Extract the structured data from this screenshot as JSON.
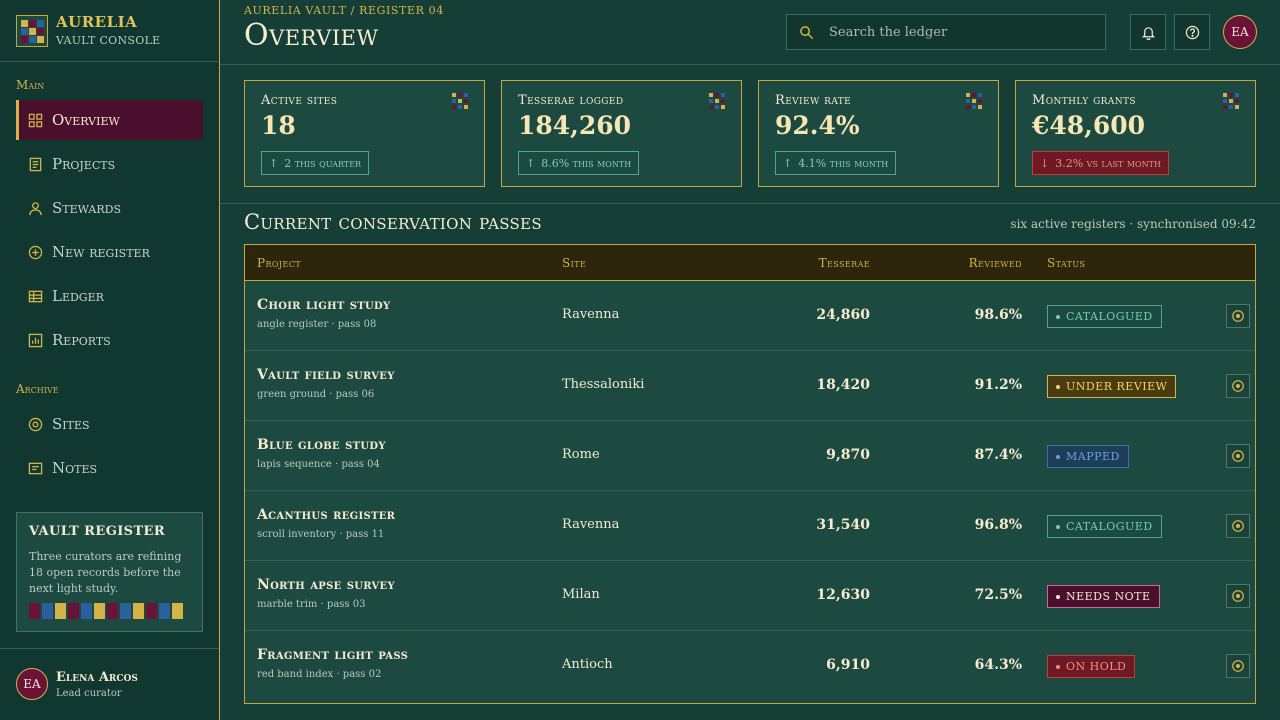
{
  "brand": {
    "name": "AURELIA",
    "subtitle": "VAULT CONSOLE"
  },
  "nav": {
    "main_label": "Main",
    "archive_label": "Archive",
    "main_items": [
      {
        "label": "Overview",
        "icon": "grid-icon",
        "active": true
      },
      {
        "label": "Projects",
        "icon": "document-icon"
      },
      {
        "label": "Stewards",
        "icon": "user-icon"
      },
      {
        "label": "New register",
        "icon": "plus-circle-icon"
      },
      {
        "label": "Ledger",
        "icon": "table-icon"
      },
      {
        "label": "Reports",
        "icon": "chart-icon"
      }
    ],
    "archive_items": [
      {
        "label": "Sites",
        "icon": "target-icon"
      },
      {
        "label": "Notes",
        "icon": "note-icon"
      }
    ]
  },
  "vault_card": {
    "title": "VAULT REGISTER",
    "text": "Three curators are refining 18 open records before the next light study."
  },
  "user": {
    "initials": "EA",
    "name": "Elena Arcos",
    "role": "Lead curator"
  },
  "header": {
    "breadcrumb": "AURELIA VAULT / REGISTER 04",
    "title": "Overview",
    "search_placeholder": "Search the ledger",
    "avatar_initials": "EA"
  },
  "stats": [
    {
      "label": "Active sites",
      "value": "18",
      "delta": "2 this quarter",
      "direction": "up"
    },
    {
      "label": "Tesserae logged",
      "value": "184,260",
      "delta": "8.6% this month",
      "direction": "up"
    },
    {
      "label": "Review rate",
      "value": "92.4%",
      "delta": "4.1% this month",
      "direction": "up"
    },
    {
      "label": "Monthly grants",
      "value": "€48,600",
      "delta": "3.2% vs last month",
      "direction": "down"
    }
  ],
  "table": {
    "title": "Current conservation passes",
    "meta": "six active registers · synchronised 09:42",
    "columns": [
      "Project",
      "Site",
      "Tesserae",
      "Reviewed",
      "Status"
    ],
    "rows": [
      {
        "project": "Choir light study",
        "sub": "angle register · pass 08",
        "site": "Ravenna",
        "tesserae": "24,860",
        "reviewed": "98.6%",
        "status": "CATALOGUED",
        "status_kind": "catalogued"
      },
      {
        "project": "Vault field survey",
        "sub": "green ground · pass 06",
        "site": "Thessaloniki",
        "tesserae": "18,420",
        "reviewed": "91.2%",
        "status": "UNDER REVIEW",
        "status_kind": "review"
      },
      {
        "project": "Blue globe study",
        "sub": "lapis sequence · pass 04",
        "site": "Rome",
        "tesserae": "9,870",
        "reviewed": "87.4%",
        "status": "MAPPED",
        "status_kind": "mapped"
      },
      {
        "project": "Acanthus register",
        "sub": "scroll inventory · pass 11",
        "site": "Ravenna",
        "tesserae": "31,540",
        "reviewed": "96.8%",
        "status": "CATALOGUED",
        "status_kind": "catalogued"
      },
      {
        "project": "North apse survey",
        "sub": "marble trim · pass 03",
        "site": "Milan",
        "tesserae": "12,630",
        "reviewed": "72.5%",
        "status": "NEEDS NOTE",
        "status_kind": "note"
      },
      {
        "project": "Fragment light pass",
        "sub": "red band index · pass 02",
        "site": "Antioch",
        "tesserae": "6,910",
        "reviewed": "64.3%",
        "status": "ON HOLD",
        "status_kind": "hold"
      }
    ]
  },
  "colors": {
    "background": "#153f36",
    "accent_gold": "#d4b349",
    "crimson": "#4a0f2c",
    "positive": "#6fd0ad",
    "negative": "#c53b3b"
  }
}
